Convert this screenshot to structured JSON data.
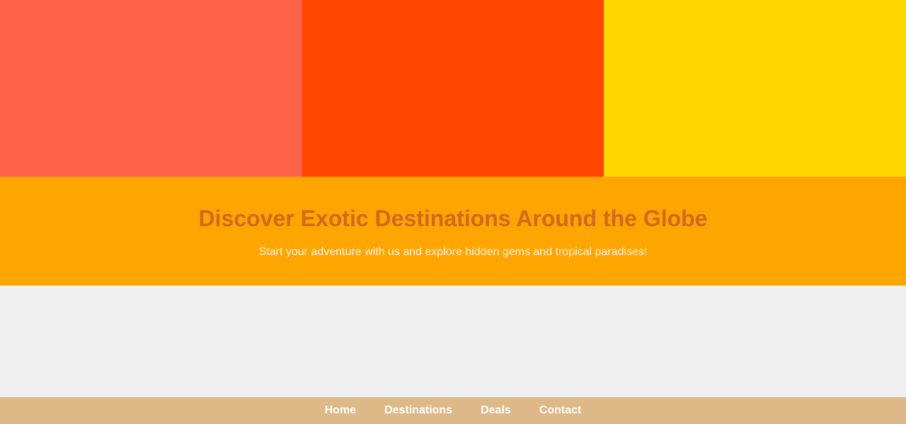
{
  "colors": {
    "banner_panel_1": "#ff6347",
    "banner_panel_2": "#ff4500",
    "banner_panel_3": "#ffd700",
    "hero_background": "#ffa500",
    "hero_title": "#d2691e",
    "hero_subtitle": "#fff5e1",
    "page_background": "#efefef",
    "navbar_background": "#deb887",
    "nav_text": "#ffffff"
  },
  "hero": {
    "title": "Discover Exotic Destinations Around the Globe",
    "subtitle": "Start your adventure with us and explore hidden gems and tropical paradises!"
  },
  "nav": {
    "items": [
      {
        "label": "Home"
      },
      {
        "label": "Destinations"
      },
      {
        "label": "Deals"
      },
      {
        "label": "Contact"
      }
    ]
  }
}
